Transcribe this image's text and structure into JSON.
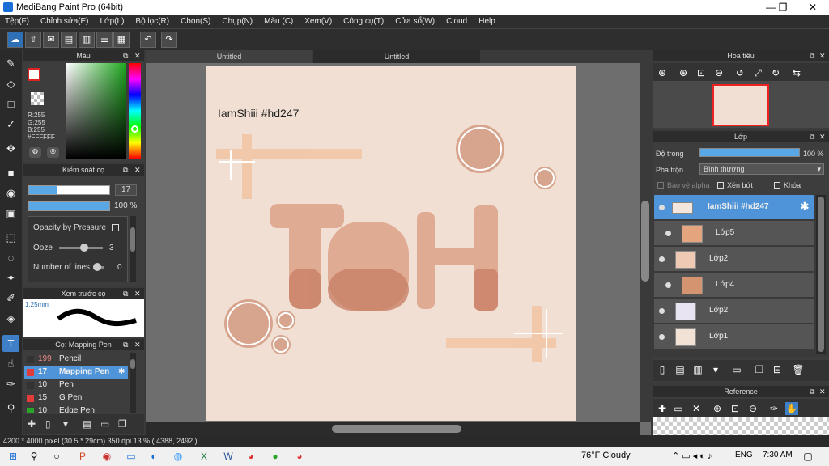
{
  "window": {
    "title": "MediBang Paint Pro (64bit)",
    "min": "—",
    "max": "❐",
    "close": "✕"
  },
  "menu": [
    "Tệp(F)",
    "Chỉnh sửa(E)",
    "Lớp(L)",
    "Bộ lọc(R)",
    "Chọn(S)",
    "Chụp(N)",
    "Màu (C)",
    "Xem(V)",
    "Công cụ(T)",
    "Cửa sổ(W)",
    "Cloud",
    "Help"
  ],
  "panels": {
    "color": {
      "title": "Màu",
      "r": "R:255",
      "g": "G:255",
      "b": "B:255",
      "hex": "#FFFFFF"
    },
    "brush_control": {
      "title": "Kiểm soát cọ",
      "size": "17",
      "opacity": "100 %",
      "opacity_pressure": "Opacity by Pressure",
      "ooze_label": "Ooze",
      "ooze_value": "3",
      "lines_label": "Number of lines",
      "lines_value": "0"
    },
    "preview": {
      "title": "Xem trước cọ",
      "size": "1.25mm"
    },
    "brushes": {
      "title": "Cọ: Mapping Pen",
      "items": [
        {
          "num": "199",
          "name": "Pencil",
          "color": "#333333"
        },
        {
          "num": "17",
          "name": "Mapping Pen",
          "color": "#e23b3b"
        },
        {
          "num": "10",
          "name": "Pen",
          "color": "#333333"
        },
        {
          "num": "15",
          "name": "G Pen",
          "color": "#e23b3b"
        },
        {
          "num": "10",
          "name": "Edge Pen",
          "color": "#2aa52a"
        }
      ]
    }
  },
  "tabs": [
    "Untitled",
    "Untitled"
  ],
  "artwork": {
    "caption": "IamShiii #hd247",
    "title_text": "TỐ H"
  },
  "navigator": {
    "title": "Hoa tiêu"
  },
  "layers": {
    "title": "Lớp",
    "opacity_label": "Độ trong",
    "opacity_value": "100 %",
    "blend_label": "Pha trộn",
    "blend_value": "Bình thường",
    "protect_alpha": "Bảo vệ alpha",
    "clip": "Xén bớt",
    "lock": "Khóa",
    "items": [
      {
        "name": "IamShiii #hd247",
        "selected": true,
        "indent": false
      },
      {
        "name": "Lớp5",
        "selected": false,
        "indent": true
      },
      {
        "name": "Lớp2",
        "selected": false,
        "indent": false
      },
      {
        "name": "Lớp4",
        "selected": false,
        "indent": true
      },
      {
        "name": "Lớp2",
        "selected": false,
        "indent": false
      },
      {
        "name": "Lớp1",
        "selected": false,
        "indent": false
      }
    ]
  },
  "reference": {
    "title": "Reference"
  },
  "status": "4200 * 4000 pixel  (30.5 * 29cm)  350 dpi  13 %  ( 4388, 2492 )",
  "taskbar": {
    "weather": "76°F  Cloudy",
    "lang": "ENG",
    "time": "7:30 AM"
  },
  "colors": {
    "accent": "#4f94d8",
    "paper": "#f0dfd2",
    "art_brown": "#d99a7a"
  }
}
